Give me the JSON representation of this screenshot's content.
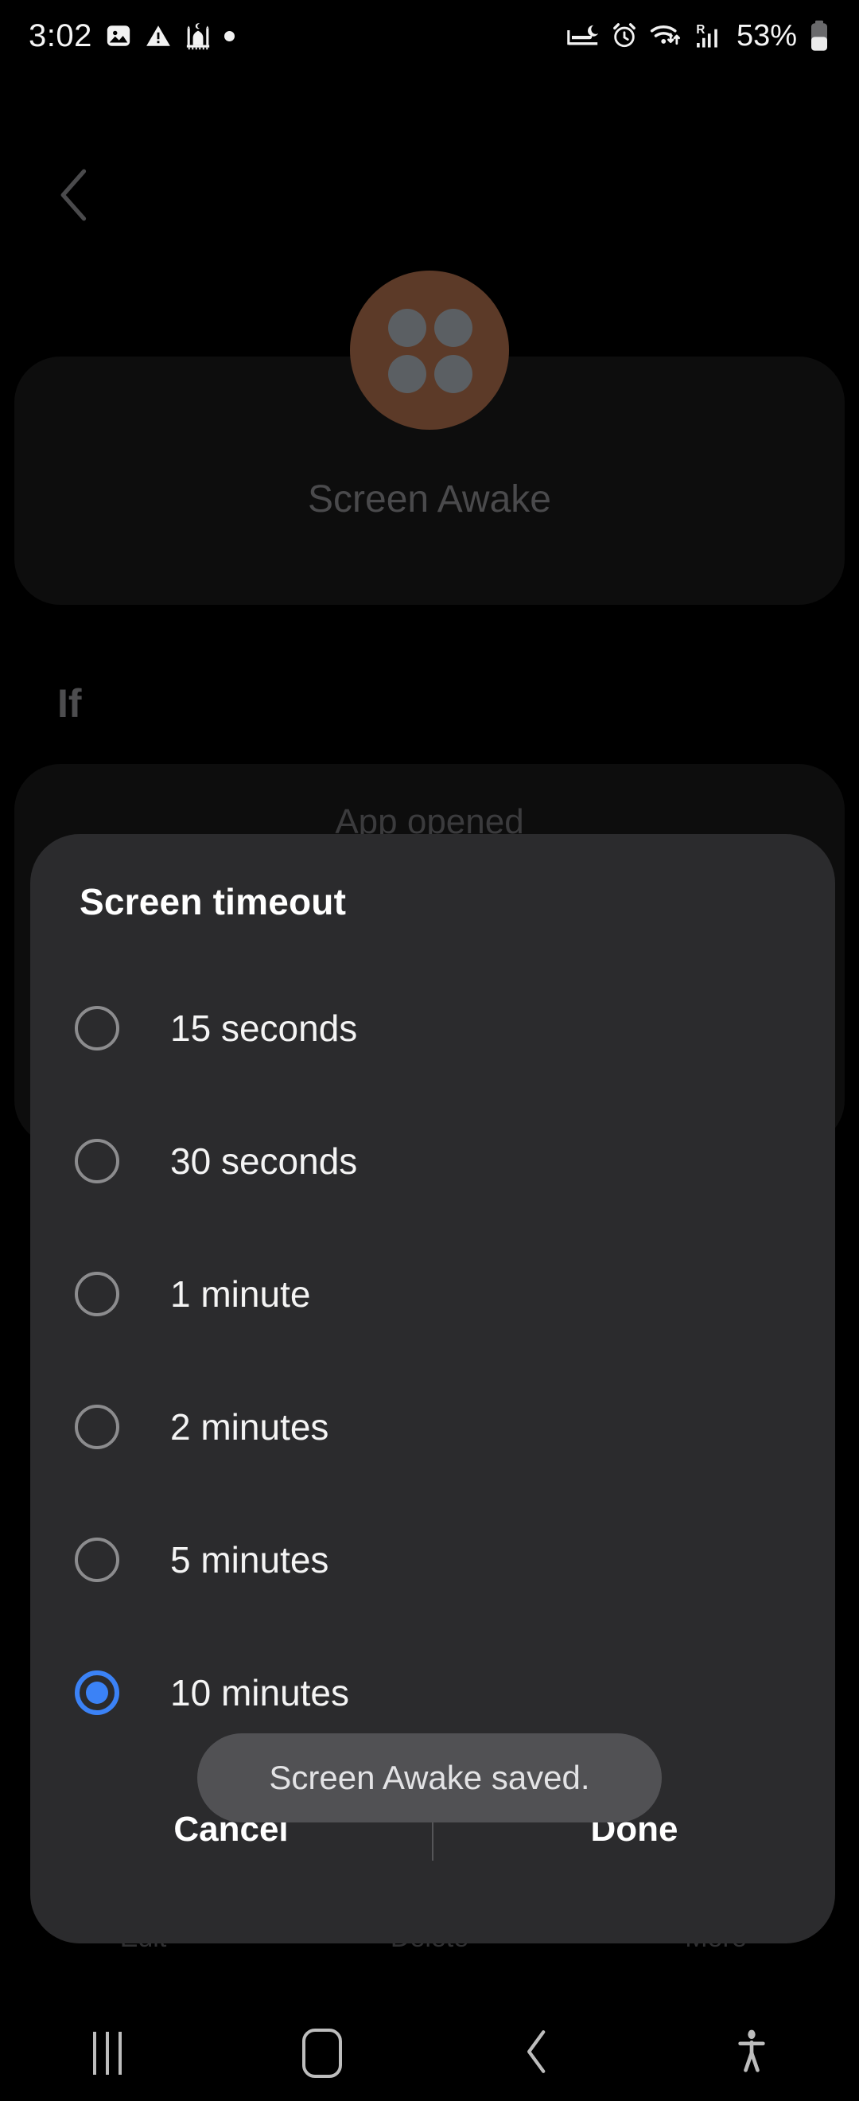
{
  "status_bar": {
    "time": "3:02",
    "left_icons": [
      "image-icon",
      "warning-triangle-icon",
      "mosque-icon",
      "dot-indicator-icon"
    ],
    "right_icons": [
      "sleep-mode-icon",
      "alarm-clock-icon",
      "wifi-data-icon",
      "roaming-signal-icon"
    ],
    "battery_percent": "53%",
    "battery_icon": "battery-icon"
  },
  "nav": {
    "back_icon": "back-chevron-icon"
  },
  "background": {
    "app_icon_name": "screen-awake-app-icon",
    "app_icon_color": "#5c3a28",
    "app_title": "Screen Awake",
    "section_label": "If",
    "trigger_text": "App opened",
    "bottom_actions": [
      {
        "label": "Edit",
        "name": "edit"
      },
      {
        "label": "Delete",
        "name": "delete"
      },
      {
        "label": "More",
        "name": "more"
      }
    ]
  },
  "dialog": {
    "title": "Screen timeout",
    "selected_value": "10 minutes",
    "accent_color": "#3b82f6",
    "options": [
      {
        "label": "15 seconds",
        "selected": false
      },
      {
        "label": "30 seconds",
        "selected": false
      },
      {
        "label": "1 minute",
        "selected": false
      },
      {
        "label": "2 minutes",
        "selected": false
      },
      {
        "label": "5 minutes",
        "selected": false
      },
      {
        "label": "10 minutes",
        "selected": true
      }
    ],
    "cancel_label": "Cancel",
    "done_label": "Done"
  },
  "toast": {
    "message": "Screen Awake saved."
  },
  "system_nav": {
    "recents_icon": "recents-icon",
    "home_icon": "home-icon",
    "back_icon": "system-back-icon",
    "accessibility_icon": "accessibility-icon"
  }
}
